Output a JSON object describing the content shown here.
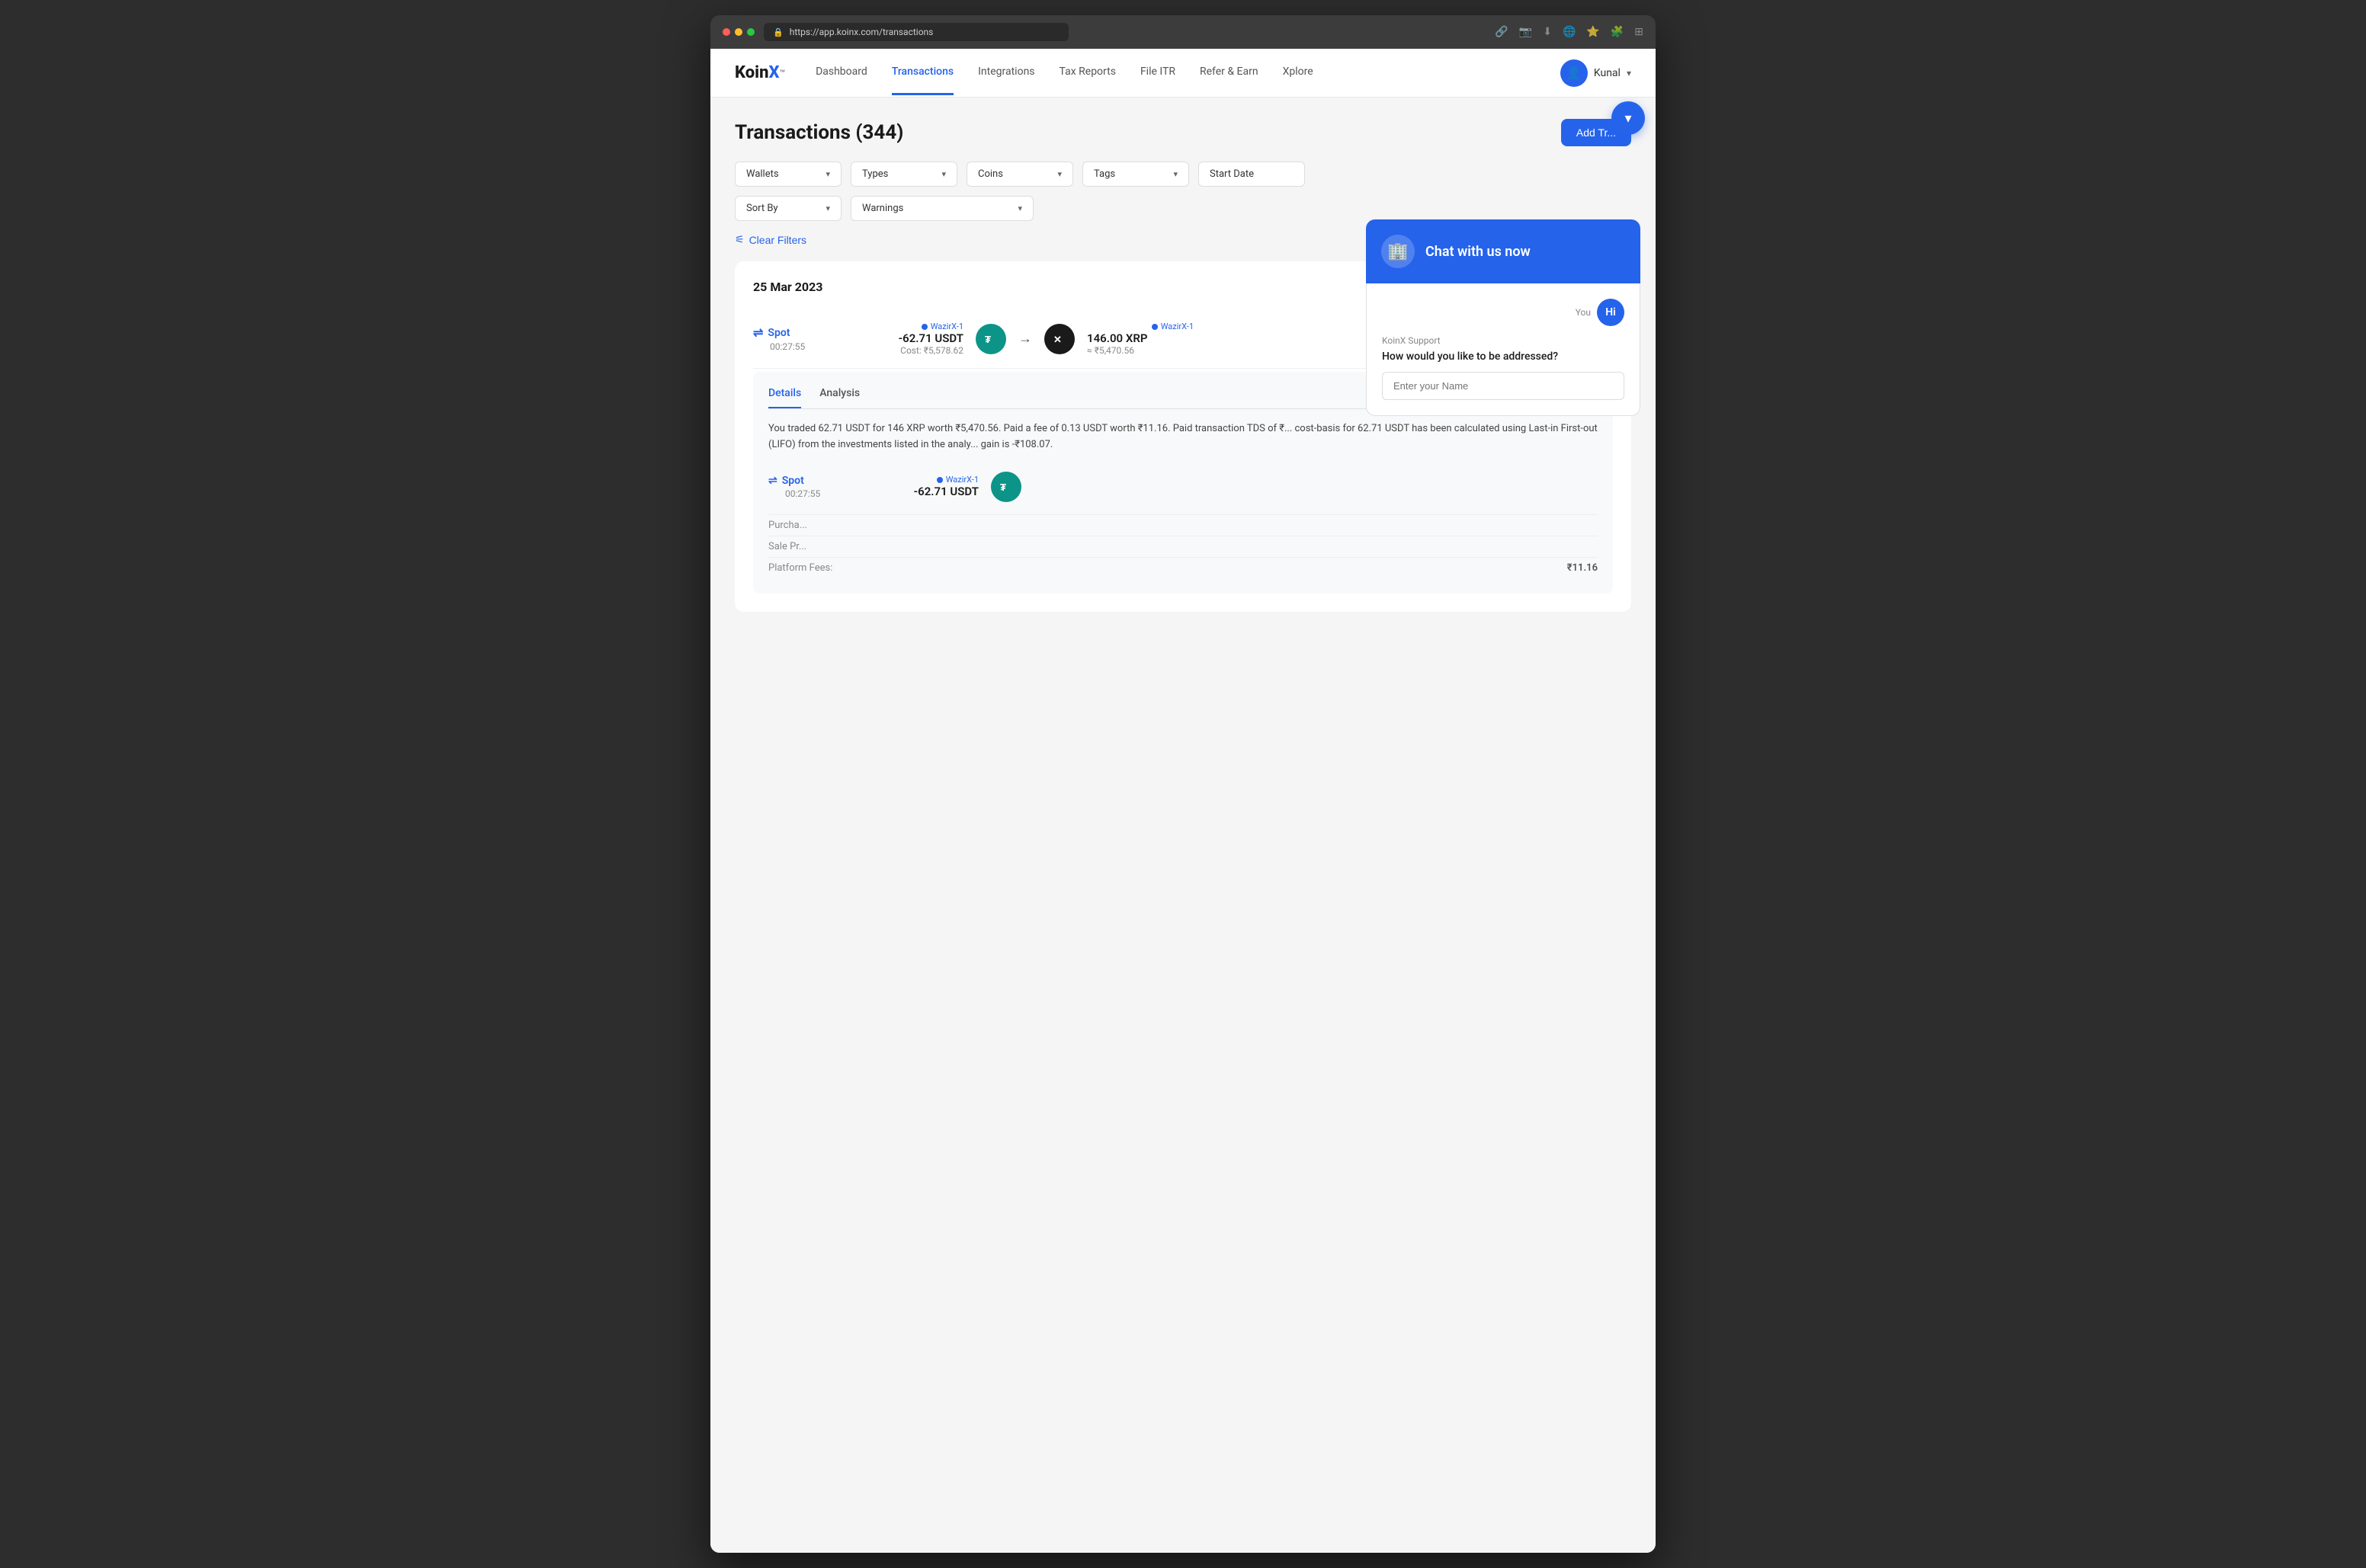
{
  "browser": {
    "url": "https://app.koinx.com/transactions"
  },
  "navbar": {
    "logo": "KoinX",
    "logo_koin": "Koin",
    "logo_x": "X",
    "logo_tm": "™",
    "links": [
      {
        "label": "Dashboard",
        "active": false
      },
      {
        "label": "Transactions",
        "active": true
      },
      {
        "label": "Integrations",
        "active": false
      },
      {
        "label": "Tax Reports",
        "active": false
      },
      {
        "label": "File ITR",
        "active": false
      },
      {
        "label": "Refer & Earn",
        "active": false
      },
      {
        "label": "Xplore",
        "active": false
      }
    ],
    "user_name": "Kunal"
  },
  "page": {
    "title": "Transactions (344)",
    "add_button": "Add Tr..."
  },
  "filters": {
    "wallets": "Wallets",
    "types": "Types",
    "coins": "Coins",
    "tags": "Tags",
    "start_date": "Start Date",
    "sort_by": "Sort By",
    "warnings": "Warnings",
    "clear_filters": "Clear Filters"
  },
  "transaction_date": "25 Mar 2023",
  "transaction": {
    "type": "Spot",
    "time": "00:27:55",
    "from_wallet": "WazirX-1",
    "from_amount": "-62.71 USDT",
    "from_cost": "Cost: ₹5,578.62",
    "to_wallet": "WazirX-1",
    "to_amount": "146.00 XRP",
    "to_value": "≈ ₹5,470.56",
    "arrow": "→"
  },
  "details": {
    "tab_details": "Details",
    "tab_analysis": "Analysis",
    "description": "You traded 62.71 USDT for 146 XRP worth ₹5,470.56. Paid a fee of 0.13 USDT worth ₹11.16. Paid transaction TDS of ₹... cost-basis for 62.71 USDT has been calculated using Last-in First-out (LIFO) from the investments listed in the analy... gain is -₹108.07.",
    "second_tx": {
      "type": "Spot",
      "time": "00:27:55",
      "wallet": "WazirX-1",
      "amount": "-62.71 USDT"
    },
    "analysis_items": [
      {
        "label": "Purcha...",
        "value": ""
      },
      {
        "label": "Sale Pr...",
        "value": ""
      },
      {
        "label": "Platform Fees:",
        "value": "₹11.16"
      }
    ]
  },
  "chat": {
    "header_title": "Chat with us now",
    "logo_icon": "🏢",
    "you_label": "You",
    "hi_label": "Hi",
    "support_label": "KoinX Support",
    "support_msg": "How would you like to be addressed?",
    "input_placeholder": "Enter your Name"
  }
}
